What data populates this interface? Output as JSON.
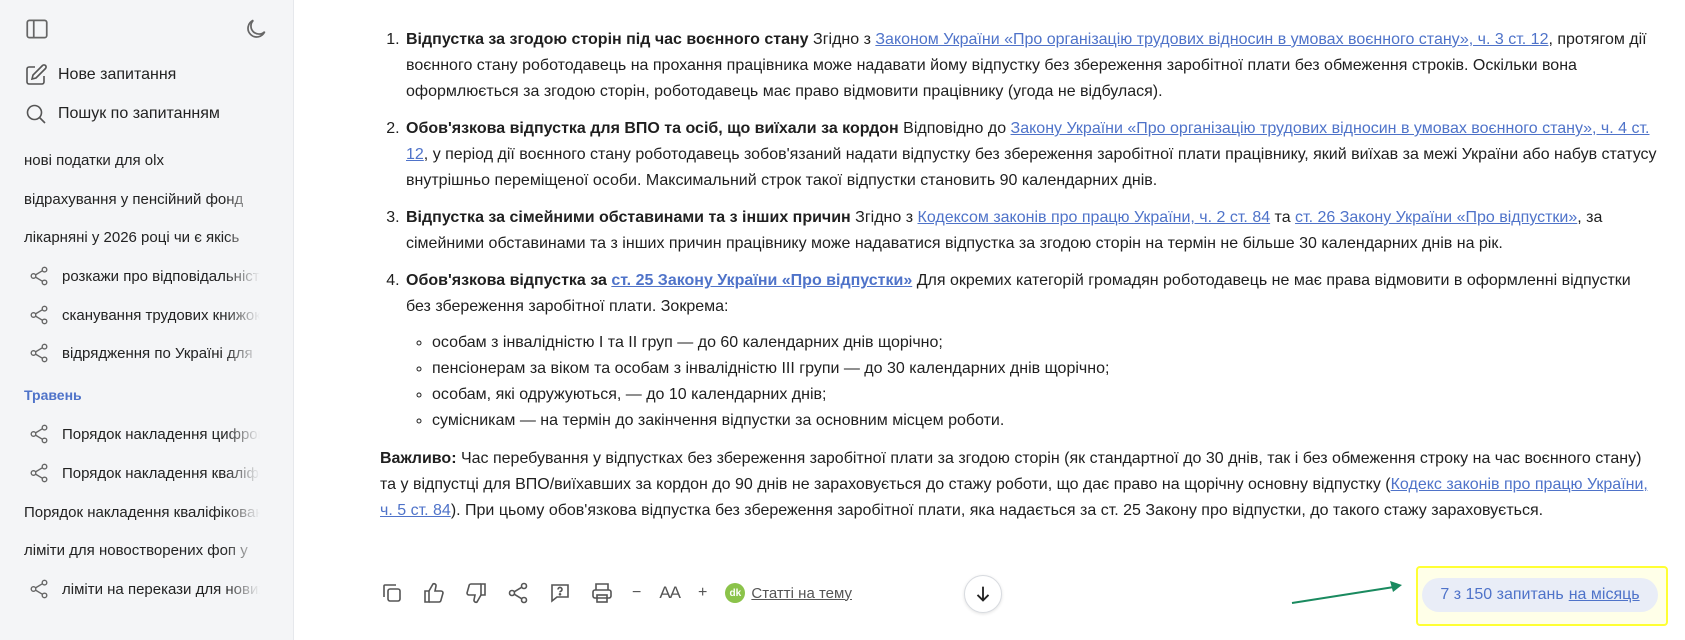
{
  "sidebar": {
    "new_request": "Нове запитання",
    "search": "Пошук по запитанням",
    "items": [
      {
        "label": "нові податки для olx",
        "shared": false
      },
      {
        "label": "відрахування у пенсійний фонд",
        "shared": false
      },
      {
        "label": "лікарняні у 2026 році чи є якісь",
        "shared": false
      },
      {
        "label": "розкажи про відповідальність",
        "shared": true
      },
      {
        "label": "сканування трудових книжок",
        "shared": true
      },
      {
        "label": "відрядження по Україні для",
        "shared": true
      }
    ],
    "section_label": "Травень",
    "section_items": [
      {
        "label": "Порядок накладення цифрового",
        "shared": true
      },
      {
        "label": "Порядок накладення кваліфікованого",
        "shared": true
      },
      {
        "label": "Порядок накладення кваліфікованого",
        "shared": false
      },
      {
        "label": "ліміти для новостворених фоп у",
        "shared": false
      },
      {
        "label": "ліміти на перекази для нових",
        "shared": true
      }
    ]
  },
  "content": {
    "item1": {
      "title": "Відпустка за згодою сторін під час воєнного стану",
      "pre": " Згідно з ",
      "link": "Законом України «Про організацію трудових відносин в умовах воєнного стану», ч. 3 ст. 12",
      "post": ", протягом дії воєнного стану роботодавець на прохання працівника може надавати йому відпустку без збереження заробітної плати без обмеження строків. Оскільки вона оформлюється за згодою сторін, роботодавець має право відмовити працівнику (угода не відбулася)."
    },
    "item2": {
      "title": "Обов'язкова відпустка для ВПО та осіб, що виїхали за кордон",
      "pre": " Відповідно до ",
      "link": "Закону України «Про організацію трудових відносин в умовах воєнного стану», ч. 4 ст. 12",
      "post": ", у період дії воєнного стану роботодавець зобов'язаний надати відпустку без збереження заробітної плати працівнику, який виїхав за межі України або набув статусу внутрішньо переміщеної особи. Максимальний строк такої відпустки становить 90 календарних днів."
    },
    "item3": {
      "title": "Відпустка за сімейними обставинами та з інших причин",
      "pre": " Згідно з ",
      "link1": "Кодексом законів про працю України, ч. 2 ст. 84",
      "mid": " та ",
      "link2": "ст. 26 Закону України «Про відпустки»",
      "post": ", за сімейними обставинами та з інших причин працівнику може надаватися відпустка за згодою сторін на термін не більше 30 календарних днів на рік."
    },
    "item4": {
      "title": "Обов'язкова відпустка за ",
      "link": "ст. 25 Закону України «Про відпустки»",
      "post": " Для окремих категорій громадян роботодавець не має права відмовити в оформленні відпустки без збереження заробітної плати. Зокрема:",
      "bullets": [
        "особам з інвалідністю I та II груп — до 60 календарних днів щорічно;",
        "пенсіонерам за віком та особам з інвалідністю III групи — до 30 календарних днів щорічно;",
        "особам, які одружуються, — до 10 календарних днів;",
        "сумісникам — на термін до закінчення відпустки за основним місцем роботи."
      ]
    },
    "note": {
      "label": "Важливо:",
      "pre": " Час перебування у відпустках без збереження заробітної плати за згодою сторін (як стандартної до 30 днів, так і без обмеження строку на час воєнного стану) та у відпустці для ВПО/виїхавших за кордон до 90 днів не зараховується до стажу роботи, що дає право на щорічну основну відпустку (",
      "link": "Кодекс законів про працю України, ч. 5 ст. 84",
      "post": "). При цьому обов'язкова відпустка без збереження заробітної плати, яка надається за ст. 25 Закону про відпустки, до такого стажу зараховується."
    }
  },
  "toolbar": {
    "minus": "−",
    "font": "AA",
    "plus": "+",
    "dk": "dk",
    "articles": "Статті на тему"
  },
  "quota": {
    "text": "7 з 150 запитань",
    "link": "на місяць"
  },
  "colors": {
    "accent": "#4f73c9",
    "highlight_border": "#ffff33",
    "arrow": "#1a8a5f",
    "dk_badge": "#8bc34a"
  }
}
